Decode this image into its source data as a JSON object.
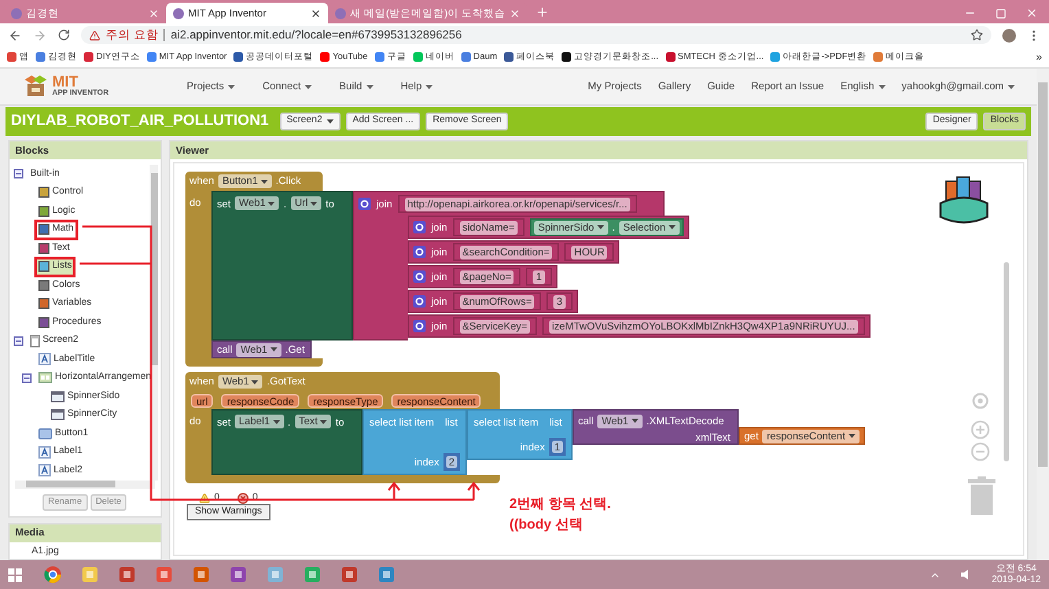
{
  "browser": {
    "tabs": [
      {
        "title": "김경현",
        "selected": false
      },
      {
        "title": "MIT App Inventor",
        "selected": true
      },
      {
        "title": "새 메일(받은메일함)이 도착했습",
        "selected": false
      }
    ],
    "security": "주의 요함",
    "url": "ai2.appinventor.mit.edu/?locale=en#6739953132896256",
    "bookmarks": [
      {
        "label": "앱",
        "color": "#e0443a"
      },
      {
        "label": "김경현",
        "color": "#4a7fe0"
      },
      {
        "label": "DIY연구소",
        "color": "#d8283a"
      },
      {
        "label": "MIT App Inventor",
        "color": "#4285f4"
      },
      {
        "label": "공공데이터포털",
        "color": "#2d5aa8"
      },
      {
        "label": "YouTube",
        "color": "#ff0000"
      },
      {
        "label": "구글",
        "color": "#4285f4"
      },
      {
        "label": "네이버",
        "color": "#03c75a"
      },
      {
        "label": "Daum",
        "color": "#4a7fe0"
      },
      {
        "label": "페이스북",
        "color": "#3b5998"
      },
      {
        "label": "고양경기문화창조...",
        "color": "#111111"
      },
      {
        "label": "SMTECH 중소기업...",
        "color": "#c8102e"
      },
      {
        "label": "아래한글->PDF변환",
        "color": "#1fa3e0"
      },
      {
        "label": "메이크올",
        "color": "#e07b39"
      }
    ],
    "more": "»"
  },
  "app": {
    "logo": {
      "title": "MIT",
      "subtitle": "APP INVENTOR"
    },
    "menus": [
      "Projects",
      "Connect",
      "Build",
      "Help"
    ],
    "links": [
      "My Projects",
      "Gallery",
      "Guide",
      "Report an Issue"
    ],
    "language": "English",
    "account": "yahookgh@gmail.com"
  },
  "project": {
    "name": "DIYLAB_ROBOT_AIR_POLLUTION1",
    "screen": "Screen2",
    "buttons": [
      "Add Screen ...",
      "Remove Screen"
    ],
    "views": [
      {
        "label": "Designer",
        "selected": false
      },
      {
        "label": "Blocks",
        "selected": true
      }
    ]
  },
  "blocks_panel": {
    "title": "Blocks",
    "tree": [
      {
        "label": "Built-in",
        "kind": "group",
        "expanded": true,
        "selected": false,
        "children": [
          {
            "label": "Control",
            "kind": "category",
            "color": "#c8a33c",
            "selected": false,
            "outlined": false
          },
          {
            "label": "Logic",
            "kind": "category",
            "color": "#7fa83a",
            "selected": false,
            "outlined": false
          },
          {
            "label": "Math",
            "kind": "category",
            "color": "#3f6fb0",
            "selected": false,
            "outlined": true
          },
          {
            "label": "Text",
            "kind": "category",
            "color": "#b83d6b",
            "selected": false,
            "outlined": false
          },
          {
            "label": "Lists",
            "kind": "category",
            "color": "#5bb3d9",
            "selected": true,
            "outlined": true
          },
          {
            "label": "Colors",
            "kind": "category",
            "color": "#7a7a7a",
            "selected": false,
            "outlined": false
          },
          {
            "label": "Variables",
            "kind": "category",
            "color": "#d0662a",
            "selected": false,
            "outlined": false
          },
          {
            "label": "Procedures",
            "kind": "category",
            "color": "#7b4e96",
            "selected": false,
            "outlined": false
          }
        ]
      },
      {
        "label": "Screen2",
        "kind": "screen",
        "expanded": true,
        "selected": false,
        "children": [
          {
            "label": "LabelTitle",
            "kind": "label",
            "selected": false
          },
          {
            "label": "HorizontalArrangemen",
            "kind": "arrangement",
            "expanded": true,
            "selected": false,
            "children": [
              {
                "label": "SpinnerSido",
                "kind": "spinner",
                "selected": false
              },
              {
                "label": "SpinnerCity",
                "kind": "spinner",
                "selected": false
              }
            ]
          },
          {
            "label": "Button1",
            "kind": "button",
            "selected": false
          },
          {
            "label": "Label1",
            "kind": "label",
            "selected": false
          },
          {
            "label": "Label2",
            "kind": "label",
            "selected": false
          }
        ]
      }
    ],
    "buttons": [
      "Rename",
      "Delete"
    ]
  },
  "media_panel": {
    "title": "Media",
    "items": [
      "A1.jpg"
    ]
  },
  "viewer": {
    "title": "Viewer",
    "event_click": {
      "when": "when",
      "component": "Button1",
      "event": ".Click",
      "do": "do",
      "setter": {
        "set": "set",
        "component": "Web1",
        "dot": ".",
        "property": "Url",
        "to": "to"
      },
      "join": {
        "label": "join",
        "text": "http://openapi.airkorea.or.kr/openapi/services/r...",
        "rows": [
          {
            "label": "join",
            "text": "sidoName=",
            "kind": "getter",
            "component": "SpinnerSido",
            "dot": ".",
            "property": "Selection"
          },
          {
            "label": "join",
            "text": "&searchCondition=",
            "kind": "text",
            "value": "HOUR"
          },
          {
            "label": "join",
            "text": "&pageNo=",
            "kind": "text",
            "value": "1"
          },
          {
            "label": "join",
            "text": "&numOfRows=",
            "kind": "text",
            "value": "3"
          },
          {
            "label": "join",
            "text": "&ServiceKey=",
            "kind": "text",
            "value": "izeMTwOVuSvihzmOYoLBOKxlMbIZnkH3Qw4XP1a9NRiRUYUJ..."
          }
        ]
      },
      "call": {
        "call": "call",
        "component": "Web1",
        "method": ".Get"
      }
    },
    "event_text": {
      "when": "when",
      "component": "Web1",
      "event": ".GotText",
      "params": [
        "url",
        "responseCode",
        "responseType",
        "responseContent"
      ],
      "do": "do",
      "setter": {
        "set": "set",
        "component": "Label1",
        "dot": ".",
        "property": "Text",
        "to": "to"
      },
      "outer_select": {
        "label": "select list item",
        "list": "list",
        "index": "index",
        "value": "2"
      },
      "inner_select": {
        "label": "select list item",
        "list": "list",
        "index": "index",
        "value": "1"
      },
      "call": {
        "call": "call",
        "component": "Web1",
        "method": ".XMLTextDecode",
        "arg": "xmlText"
      },
      "get": {
        "label": "get",
        "variable": "responseContent"
      }
    },
    "warnings": {
      "warning_count": "0",
      "error_count": "0",
      "button": "Show Warnings"
    },
    "annotation": [
      "2번째 항목 선택.",
      "((body 선택"
    ]
  },
  "taskbar": {
    "time": "오전 6:54",
    "date": "2019-04-12"
  }
}
